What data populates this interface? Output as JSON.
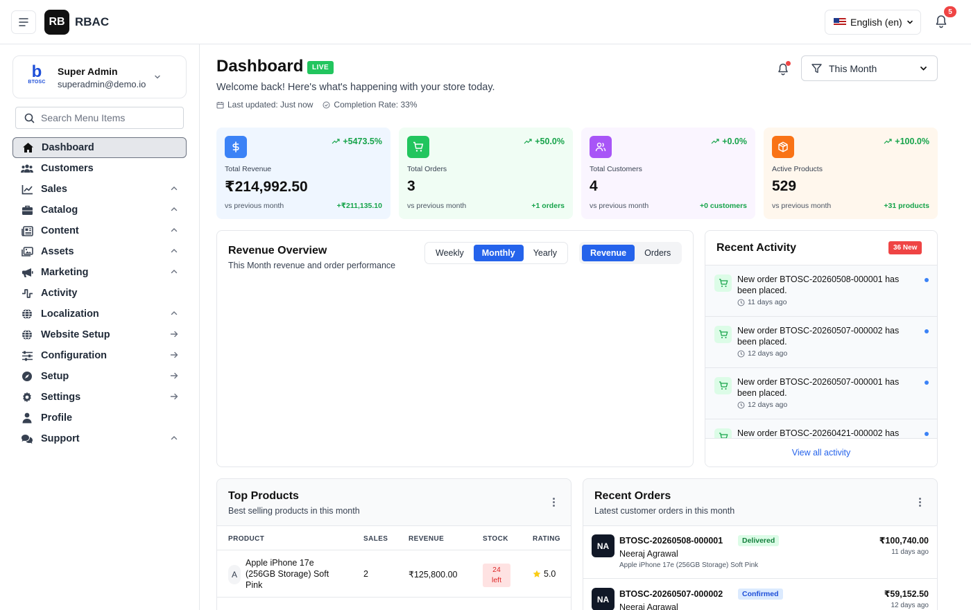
{
  "header": {
    "logo_initials": "RB",
    "app_name": "RBAC",
    "language": "English (en)",
    "notification_count": "5"
  },
  "sidebar": {
    "user": {
      "brand_text": "BTOSC",
      "name": "Super Admin",
      "email": "superadmin@demo.io"
    },
    "search_placeholder": "Search Menu Items",
    "items": [
      {
        "label": "Dashboard",
        "icon": "home-icon"
      },
      {
        "label": "Customers",
        "icon": "users-icon"
      },
      {
        "label": "Sales",
        "icon": "chart-line-icon"
      },
      {
        "label": "Catalog",
        "icon": "briefcase-icon"
      },
      {
        "label": "Content",
        "icon": "newspaper-icon"
      },
      {
        "label": "Assets",
        "icon": "images-icon"
      },
      {
        "label": "Marketing",
        "icon": "megaphone-icon"
      },
      {
        "label": "Activity",
        "icon": "pulse-icon"
      },
      {
        "label": "Localization",
        "icon": "globe-icon"
      },
      {
        "label": "Website Setup",
        "icon": "globe-icon"
      },
      {
        "label": "Configuration",
        "icon": "sliders-icon"
      },
      {
        "label": "Setup",
        "icon": "compass-icon"
      },
      {
        "label": "Settings",
        "icon": "gear-icon"
      },
      {
        "label": "Profile",
        "icon": "user-icon"
      },
      {
        "label": "Support",
        "icon": "comments-icon"
      }
    ]
  },
  "dashboard": {
    "title": "Dashboard",
    "live_badge": "LIVE",
    "welcome": "Welcome back! Here's what's happening with your store today.",
    "last_updated": "Last updated: Just now",
    "completion": "Completion Rate: 33%",
    "period": "This Month"
  },
  "stats": [
    {
      "label": "Total Revenue",
      "value": "₹214,992.50",
      "change": "+5473.5%",
      "foot": "vs previous month",
      "delta": "+₹211,135.10",
      "color": "#3b82f6",
      "bg": "#eff6ff"
    },
    {
      "label": "Total Orders",
      "value": "3",
      "change": "+50.0%",
      "foot": "vs previous month",
      "delta": "+1 orders",
      "color": "#22c55e",
      "bg": "#f0fdf4"
    },
    {
      "label": "Total Customers",
      "value": "4",
      "change": "+0.0%",
      "foot": "vs previous month",
      "delta": "+0 customers",
      "color": "#a855f7",
      "bg": "#faf5ff"
    },
    {
      "label": "Active Products",
      "value": "529",
      "change": "+100.0%",
      "foot": "vs previous month",
      "delta": "+31 products",
      "color": "#f97316",
      "bg": "#fff7ed"
    }
  ],
  "revenue_overview": {
    "title": "Revenue Overview",
    "subtitle": "This Month revenue and order performance",
    "period_tabs": [
      "Weekly",
      "Monthly",
      "Yearly"
    ],
    "metric_tabs": [
      "Revenue",
      "Orders"
    ]
  },
  "recent_activity": {
    "title": "Recent Activity",
    "badge": "36 New",
    "items": [
      {
        "text": "New order BTOSC-20260508-000001 has been placed.",
        "time": "11 days ago"
      },
      {
        "text": "New order BTOSC-20260507-000002 has been placed.",
        "time": "12 days ago"
      },
      {
        "text": "New order BTOSC-20260507-000001 has been placed.",
        "time": "12 days ago"
      },
      {
        "text": "New order BTOSC-20260421-000002 has",
        "time": ""
      }
    ],
    "view_all": "View all activity"
  },
  "top_products": {
    "title": "Top Products",
    "subtitle": "Best selling products in this month",
    "columns": [
      "PRODUCT",
      "SALES",
      "REVENUE",
      "STOCK",
      "RATING"
    ],
    "rows": [
      {
        "initial": "A",
        "name": "Apple iPhone 17e (256GB Storage) Soft Pink",
        "sales": "2",
        "revenue": "₹125,800.00",
        "stock_num": "24",
        "stock_unit": "left",
        "rating": "5.0"
      }
    ]
  },
  "recent_orders": {
    "title": "Recent Orders",
    "subtitle": "Latest customer orders in this month",
    "orders": [
      {
        "initials": "NA",
        "id": "BTOSC-20260508-000001",
        "status": "Delivered",
        "customer": "Neeraj Agrawal",
        "product": "Apple iPhone 17e (256GB Storage) Soft Pink",
        "amount": "₹100,740.00",
        "time": "11 days ago"
      },
      {
        "initials": "NA",
        "id": "BTOSC-20260507-000002",
        "status": "Confirmed",
        "customer": "Neeraj Agrawal",
        "product": "",
        "amount": "₹59,152.50",
        "time": "12 days ago"
      }
    ]
  }
}
